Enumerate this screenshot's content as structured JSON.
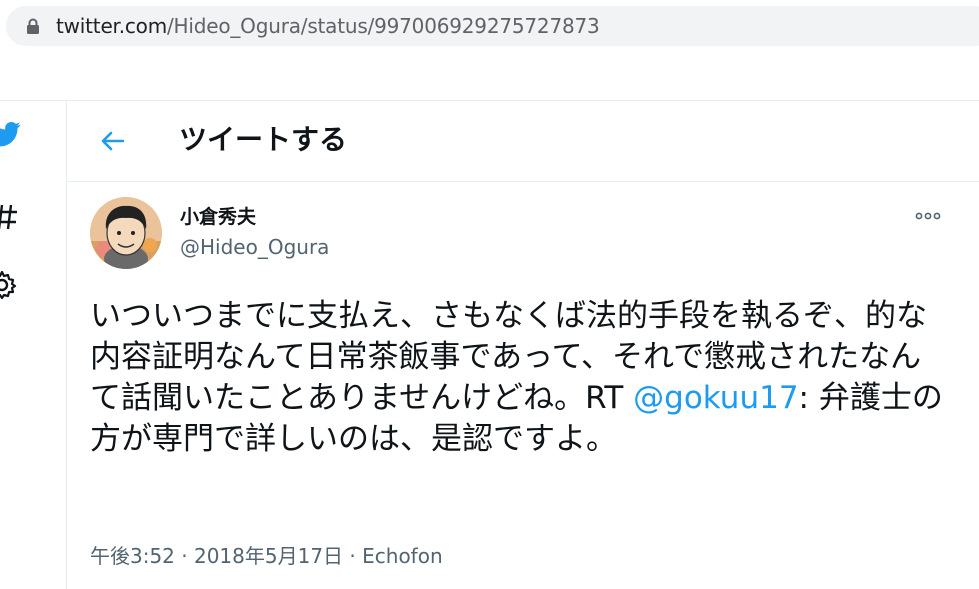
{
  "browser": {
    "url_host": "twitter.com",
    "url_path": "/Hideo_Ogura/status/997006929275727873",
    "icons": {
      "lock": "lock-icon"
    }
  },
  "nav": {
    "icons": [
      "twitter-bird-icon",
      "hashtag-icon",
      "gear-icon"
    ]
  },
  "header": {
    "title": "ツイートする",
    "back_icon": "back-arrow-icon"
  },
  "tweet": {
    "display_name": "小倉秀夫",
    "handle": "@Hideo_Ogura",
    "text_before": "いついつまでに支払え、さもなくば法的手段を執るぞ、的な内容証明なんて日常茶飯事であって、それで懲戒されたなんて話聞いたことありませんけどね。RT ",
    "mention": "@gokuu17",
    "text_after": ": 弁護士の方が専門で詳しいのは、是認ですよ。",
    "timestamp": "午後3:52 · 2018年5月17日",
    "separator": " · ",
    "source": "Echofon",
    "more_icon": "more-options-icon"
  },
  "colors": {
    "accent": "#1d9bf0",
    "text": "#0f1419",
    "secondary": "#536471",
    "border": "#e6ecf0"
  }
}
